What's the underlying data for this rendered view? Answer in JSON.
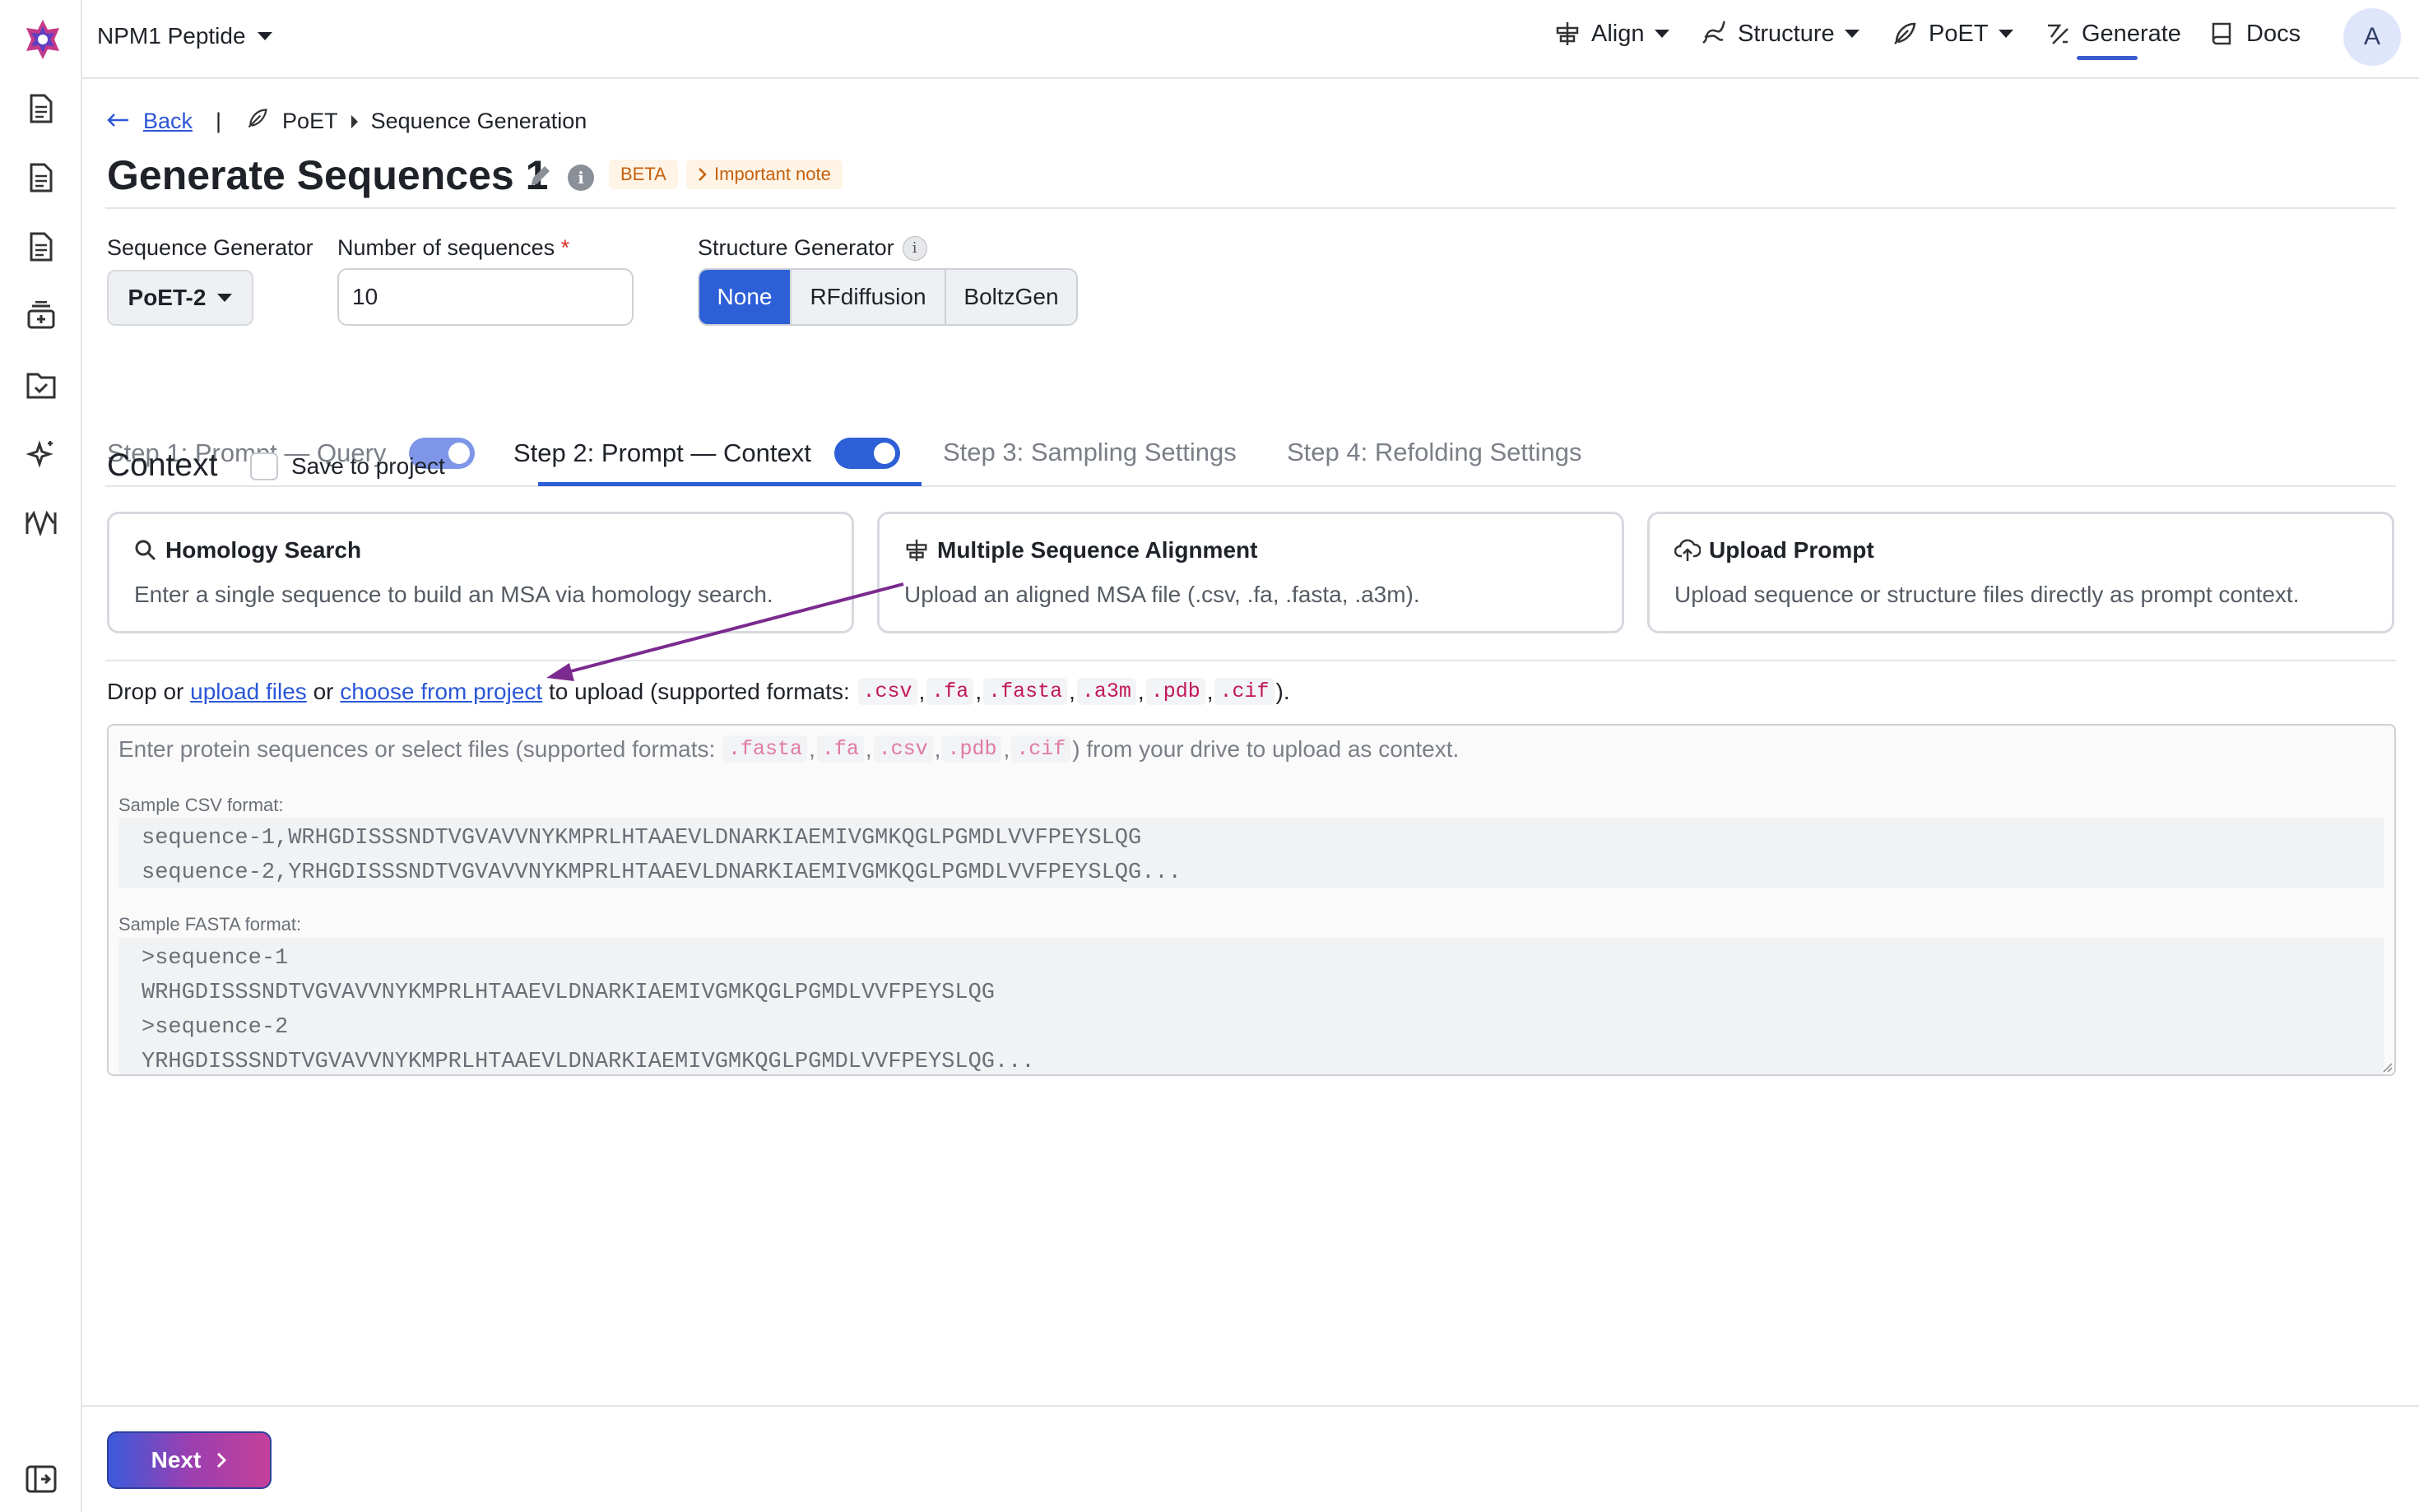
{
  "project": {
    "name": "NPM1 Peptide"
  },
  "nav": {
    "align": "Align",
    "structure": "Structure",
    "poet": "PoET",
    "generate": "Generate",
    "docs": "Docs",
    "avatar": "A"
  },
  "breadcrumb": {
    "back": "Back",
    "separator": "|",
    "section": "PoET",
    "page": "Sequence Generation"
  },
  "header": {
    "title": "Generate Sequences 1",
    "info": "i",
    "beta": "BETA",
    "note": "Important note"
  },
  "form": {
    "seq_gen_label": "Sequence Generator",
    "seq_gen_value": "PoET-2",
    "num_label": "Number of sequences",
    "num_required": "*",
    "num_value": "10",
    "struct_label": "Structure Generator",
    "struct_options": [
      "None",
      "RFdiffusion",
      "BoltzGen"
    ],
    "struct_selected": "None"
  },
  "tabs": {
    "step1": "Step 1: Prompt — Query",
    "step2": "Step 2: Prompt — Context",
    "step3": "Step 3: Sampling Settings",
    "step4": "Step 4: Refolding Settings"
  },
  "context": {
    "title": "Context",
    "save_label": "Save to project",
    "cards": [
      {
        "title": "Homology Search",
        "desc": "Enter a single sequence to build an MSA via homology search."
      },
      {
        "title": "Multiple Sequence Alignment",
        "desc": "Upload an aligned MSA file (.csv, .fa, .fasta, .a3m)."
      },
      {
        "title": "Upload Prompt",
        "desc": "Upload sequence or structure files directly as prompt context."
      }
    ]
  },
  "drop": {
    "prefix": "Drop or",
    "upload_link": "upload files",
    "or": "or",
    "project_link": "choose from project",
    "suffix": "to upload (supported formats:",
    "formats": [
      ".csv",
      ".fa",
      ".fasta",
      ".a3m",
      ".pdb",
      ".cif"
    ],
    "end": ")."
  },
  "textarea": {
    "ph_prefix": "Enter protein sequences or select files (supported formats:",
    "ph_formats": [
      ".fasta",
      ".fa",
      ".csv",
      ".pdb",
      ".cif"
    ],
    "ph_suffix": ") from your drive to upload as context.",
    "csv_label": "Sample CSV format:",
    "csv_lines": [
      "sequence-1,WRHGDISSSNDTVGVAVVNYKMPRLHTAAEVLDNARKIAEMIVGMKQGLPGMDLVVFPEYSLQG",
      "sequence-2,YRHGDISSSNDTVGVAVVNYKMPRLHTAAEVLDNARKIAEMIVGMKQGLPGMDLVVFPEYSLQG..."
    ],
    "fasta_label": "Sample FASTA format:",
    "fasta_lines": [
      ">sequence-1",
      "WRHGDISSSNDTVGVAVVNYKMPRLHTAAEVLDNARKIAEMIVGMKQGLPGMDLVVFPEYSLQG",
      ">sequence-2",
      "YRHGDISSSNDTVGVAVVNYKMPRLHTAAEVLDNARKIAEMIVGMKQGLPGMDLVVFPEYSLQG..."
    ]
  },
  "footer": {
    "next": "Next"
  },
  "colors": {
    "accent": "#2d5fd6",
    "annotation_arrow": "#7b2a8f",
    "badge_text": "#c4610f",
    "badge_bg": "#fff4e5"
  }
}
